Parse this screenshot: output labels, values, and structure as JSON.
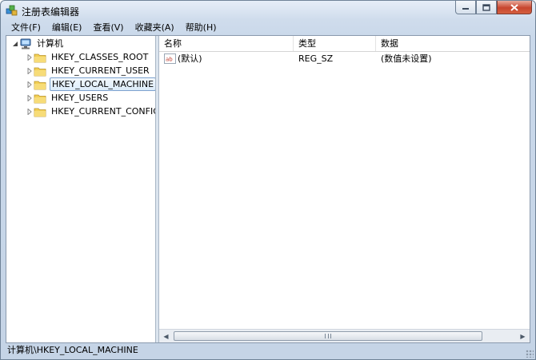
{
  "window": {
    "title": "注册表编辑器"
  },
  "menu": [
    "文件(F)",
    "编辑(E)",
    "查看(V)",
    "收藏夹(A)",
    "帮助(H)"
  ],
  "tree": {
    "root": "计算机",
    "items": [
      "HKEY_CLASSES_ROOT",
      "HKEY_CURRENT_USER",
      "HKEY_LOCAL_MACHINE",
      "HKEY_USERS",
      "HKEY_CURRENT_CONFIG"
    ],
    "selected": "HKEY_LOCAL_MACHINE"
  },
  "list": {
    "columns": [
      "名称",
      "类型",
      "数据"
    ],
    "rows": [
      {
        "name": "(默认)",
        "type": "REG_SZ",
        "data": "(数值未设置)"
      }
    ]
  },
  "status": {
    "path": "计算机\\HKEY_LOCAL_MACHINE"
  },
  "icons": {
    "app": "regedit-icon",
    "computer": "computer-icon",
    "folder": "folder-icon",
    "value": "string-value-icon"
  }
}
